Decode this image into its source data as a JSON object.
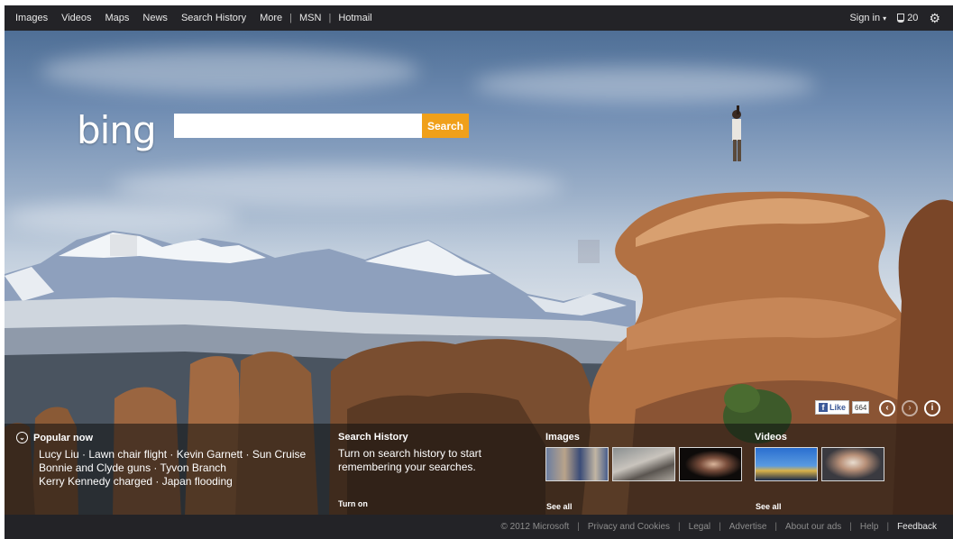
{
  "topnav": {
    "items": [
      "Images",
      "Videos",
      "Maps",
      "News",
      "Search History",
      "More"
    ],
    "sep": "|",
    "msn": "MSN",
    "hotmail": "Hotmail",
    "sign_in": "Sign in",
    "sign_in_caret": "▾",
    "rewards_count": "20",
    "settings_icon": "gear-icon"
  },
  "search": {
    "logo": "bing",
    "value": "",
    "button_label": "Search"
  },
  "social": {
    "like_label": "Like",
    "like_count": "664"
  },
  "carousel": {
    "prev_icon": "chevron-left-icon",
    "next_icon": "chevron-right-icon",
    "info_icon": "info-icon"
  },
  "popular": {
    "title": "Popular now",
    "items": [
      "Lucy Liu",
      "Lawn chair flight",
      "Kevin Garnett",
      "Sun Cruise",
      "Bonnie and Clyde guns",
      "Tyvon Branch",
      "Kerry Kennedy charged",
      "Japan flooding"
    ],
    "sep": " · "
  },
  "history": {
    "title": "Search History",
    "text": "Turn on search history to start remembering your searches.",
    "turn_on": "Turn on"
  },
  "images": {
    "title": "Images",
    "see_all": "See all"
  },
  "videos": {
    "title": "Videos",
    "see_all": "See all"
  },
  "footer": {
    "copyright": "© 2012 Microsoft",
    "links": [
      "Privacy and Cookies",
      "Legal",
      "Advertise",
      "About our ads",
      "Help"
    ],
    "feedback": "Feedback"
  },
  "colors": {
    "search_button": "#f0a01a",
    "topbar": "#232327",
    "facebook": "#3b5998"
  }
}
